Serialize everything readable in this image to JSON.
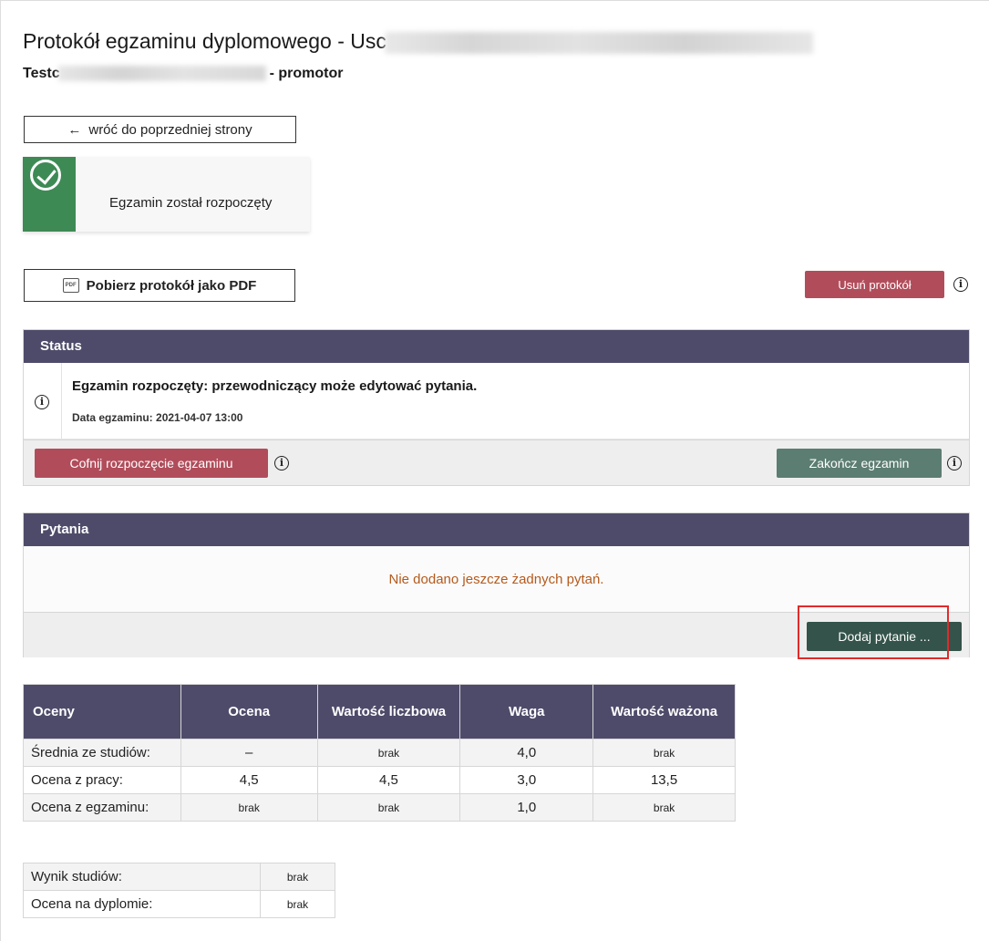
{
  "header": {
    "title_prefix": "Protokół egzaminu dyplomowego - Usc",
    "subtitle_prefix": "Testc",
    "subtitle_suffix": "- promotor"
  },
  "back_button": {
    "arrow": "←",
    "label": "wróć do poprzedniej strony"
  },
  "exam_state": {
    "label": "Egzamin został rozpoczęty",
    "icon": "check-circle-icon",
    "color": "#3e8a55"
  },
  "toolbar": {
    "pdf_label": "Pobierz protokół jako PDF",
    "pdf_icon_text": "PDF",
    "delete_label": "Usuń protokół",
    "info_glyph": "i"
  },
  "status_panel": {
    "title": "Status",
    "message": "Egzamin rozpoczęty: przewodniczący może edytować pytania.",
    "date": "Data egzaminu: 2021-04-07 13:00",
    "undo_label": "Cofnij rozpoczęcie egzaminu",
    "finish_label": "Zakończ egzamin"
  },
  "questions_panel": {
    "title": "Pytania",
    "empty_message": "Nie dodano jeszcze żadnych pytań.",
    "add_label": "Dodaj pytanie ..."
  },
  "grades_table": {
    "headers": [
      "Oceny",
      "Ocena",
      "Wartość liczbowa",
      "Waga",
      "Wartość ważona"
    ],
    "rows": [
      [
        "Średnia ze studiów:",
        "–",
        "brak",
        "4,0",
        "brak"
      ],
      [
        "Ocena z pracy:",
        "4,5",
        "4,5",
        "3,0",
        "13,5"
      ],
      [
        "Ocena z egzaminu:",
        "brak",
        "brak",
        "1,0",
        "brak"
      ]
    ]
  },
  "result_table": {
    "rows": [
      [
        "Wynik studiów:",
        "brak"
      ],
      [
        "Ocena na dyplomie:",
        "brak"
      ]
    ]
  },
  "colors": {
    "panel_header": "#4e4b6a",
    "danger": "#b14d5b",
    "finish": "#5c7d72",
    "add": "#34534a",
    "empty_message": "#b45a1c",
    "highlight": "#e02b2b"
  }
}
